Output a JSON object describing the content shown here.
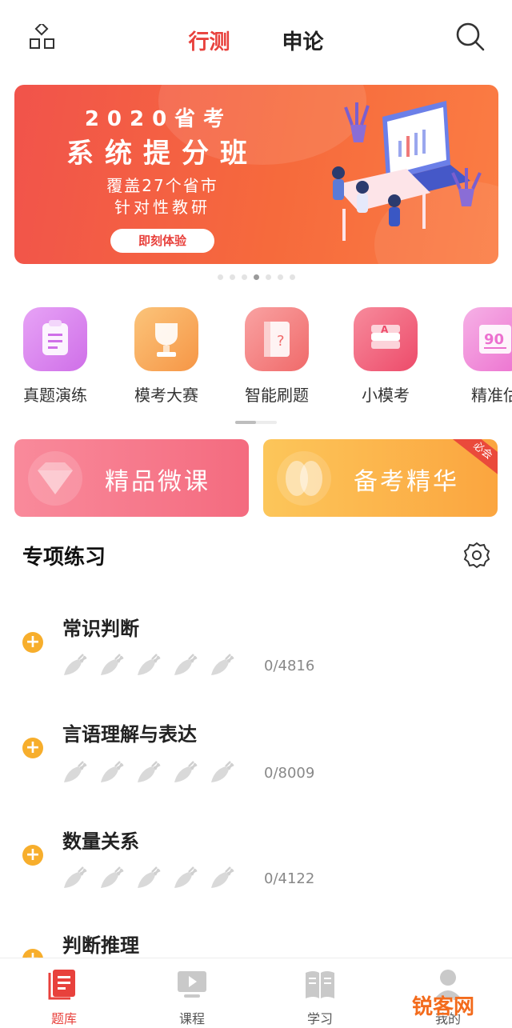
{
  "header": {
    "tabs": [
      {
        "label": "行测",
        "active": true
      },
      {
        "label": "申论",
        "active": false
      }
    ],
    "icons": [
      "grid-icon",
      "search-icon"
    ]
  },
  "banner": {
    "title1": "2020省考",
    "title2": "系统提分班",
    "sub1": "覆盖27个省市",
    "sub2": "针对性教研",
    "button": "即刻体验",
    "dots_total": 7,
    "dots_active_index": 3
  },
  "quick_actions": [
    {
      "label": "真题演练",
      "icon": "clipboard-icon",
      "color": "#d97ef0"
    },
    {
      "label": "模考大赛",
      "icon": "trophy-icon",
      "color": "#f9a95a"
    },
    {
      "label": "智能刷题",
      "icon": "book-icon",
      "color": "#f57f7f"
    },
    {
      "label": "小模考",
      "icon": "paper-stack-icon",
      "color": "#f2607a"
    },
    {
      "label": "精准估",
      "icon": "score-90-icon",
      "color": "#f08ad6"
    }
  ],
  "promos": [
    {
      "label": "精品微课",
      "icon": "gem-icon"
    },
    {
      "label": "备考精华",
      "icon": "brain-icon",
      "badge": "必会"
    }
  ],
  "section": {
    "title": "专项练习",
    "settings_icon": "gear-icon"
  },
  "practice": [
    {
      "name": "常识判断",
      "progress": "0/4816"
    },
    {
      "name": "言语理解与表达",
      "progress": "0/8009"
    },
    {
      "name": "数量关系",
      "progress": "0/4122"
    },
    {
      "name": "判断推理",
      "progress": ""
    }
  ],
  "bottom_nav": [
    {
      "label": "题库",
      "icon": "question-bank-icon",
      "active": true
    },
    {
      "label": "课程",
      "icon": "video-course-icon",
      "active": false
    },
    {
      "label": "学习",
      "icon": "open-book-icon",
      "active": false
    },
    {
      "label": "我的",
      "icon": "profile-icon",
      "active": false
    }
  ],
  "watermark": "锐客网",
  "colors": {
    "accent": "#e8413c",
    "plus": "#f7ae2c"
  }
}
